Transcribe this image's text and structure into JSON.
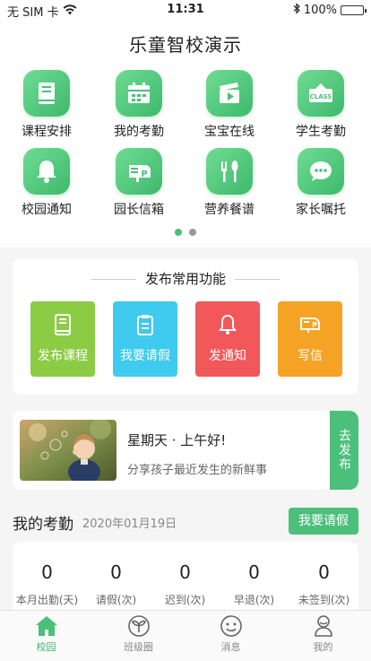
{
  "status_bar": {
    "carrier": "无 SIM 卡",
    "time": "11:31",
    "battery": "100%",
    "battery_level": 1.0
  },
  "app_title": "乐童智校演示",
  "grid": {
    "items": [
      {
        "label": "课程安排",
        "icon": "book-icon"
      },
      {
        "label": "我的考勤",
        "icon": "calendar-icon"
      },
      {
        "label": "宝宝在线",
        "icon": "video-icon"
      },
      {
        "label": "学生考勤",
        "icon": "class-board-icon"
      },
      {
        "label": "校园通知",
        "icon": "bell-icon"
      },
      {
        "label": "园长信箱",
        "icon": "mailbox-icon"
      },
      {
        "label": "营养餐谱",
        "icon": "cutlery-icon"
      },
      {
        "label": "家长嘱托",
        "icon": "chat-bubble-icon"
      }
    ],
    "page_dots": 2,
    "active_page": 1
  },
  "publish": {
    "title": "发布常用功能",
    "tiles": [
      {
        "label": "发布课程",
        "color": "#8ccc45",
        "icon": "book-icon"
      },
      {
        "label": "我要请假",
        "color": "#3fcaf0",
        "icon": "clipboard-icon"
      },
      {
        "label": "发通知",
        "color": "#f2575a",
        "icon": "bell-icon"
      },
      {
        "label": "写信",
        "color": "#f5a324",
        "icon": "mailbox-icon"
      }
    ]
  },
  "share": {
    "greeting": "星期天 · 上午好!",
    "subtitle": "分享孩子最近发生的新鲜事",
    "button": "去发布"
  },
  "attendance": {
    "title": "我的考勤",
    "date": "2020年01月19日",
    "leave_button": "我要请假",
    "stats": [
      {
        "value": "0",
        "label": "本月出勤(天)"
      },
      {
        "value": "0",
        "label": "请假(次)"
      },
      {
        "value": "0",
        "label": "迟到(次)"
      },
      {
        "value": "0",
        "label": "早退(次)"
      },
      {
        "value": "0",
        "label": "未签到(次)"
      }
    ]
  },
  "tabbar": {
    "tabs": [
      {
        "label": "校园",
        "icon": "home-icon",
        "active": true
      },
      {
        "label": "班级圈",
        "icon": "sprout-icon",
        "active": false
      },
      {
        "label": "消息",
        "icon": "smiley-icon",
        "active": false
      },
      {
        "label": "我的",
        "icon": "profile-icon",
        "active": false
      }
    ]
  },
  "colors": {
    "primary_green": "#4cbf7a",
    "background": "#f5f5f5"
  }
}
